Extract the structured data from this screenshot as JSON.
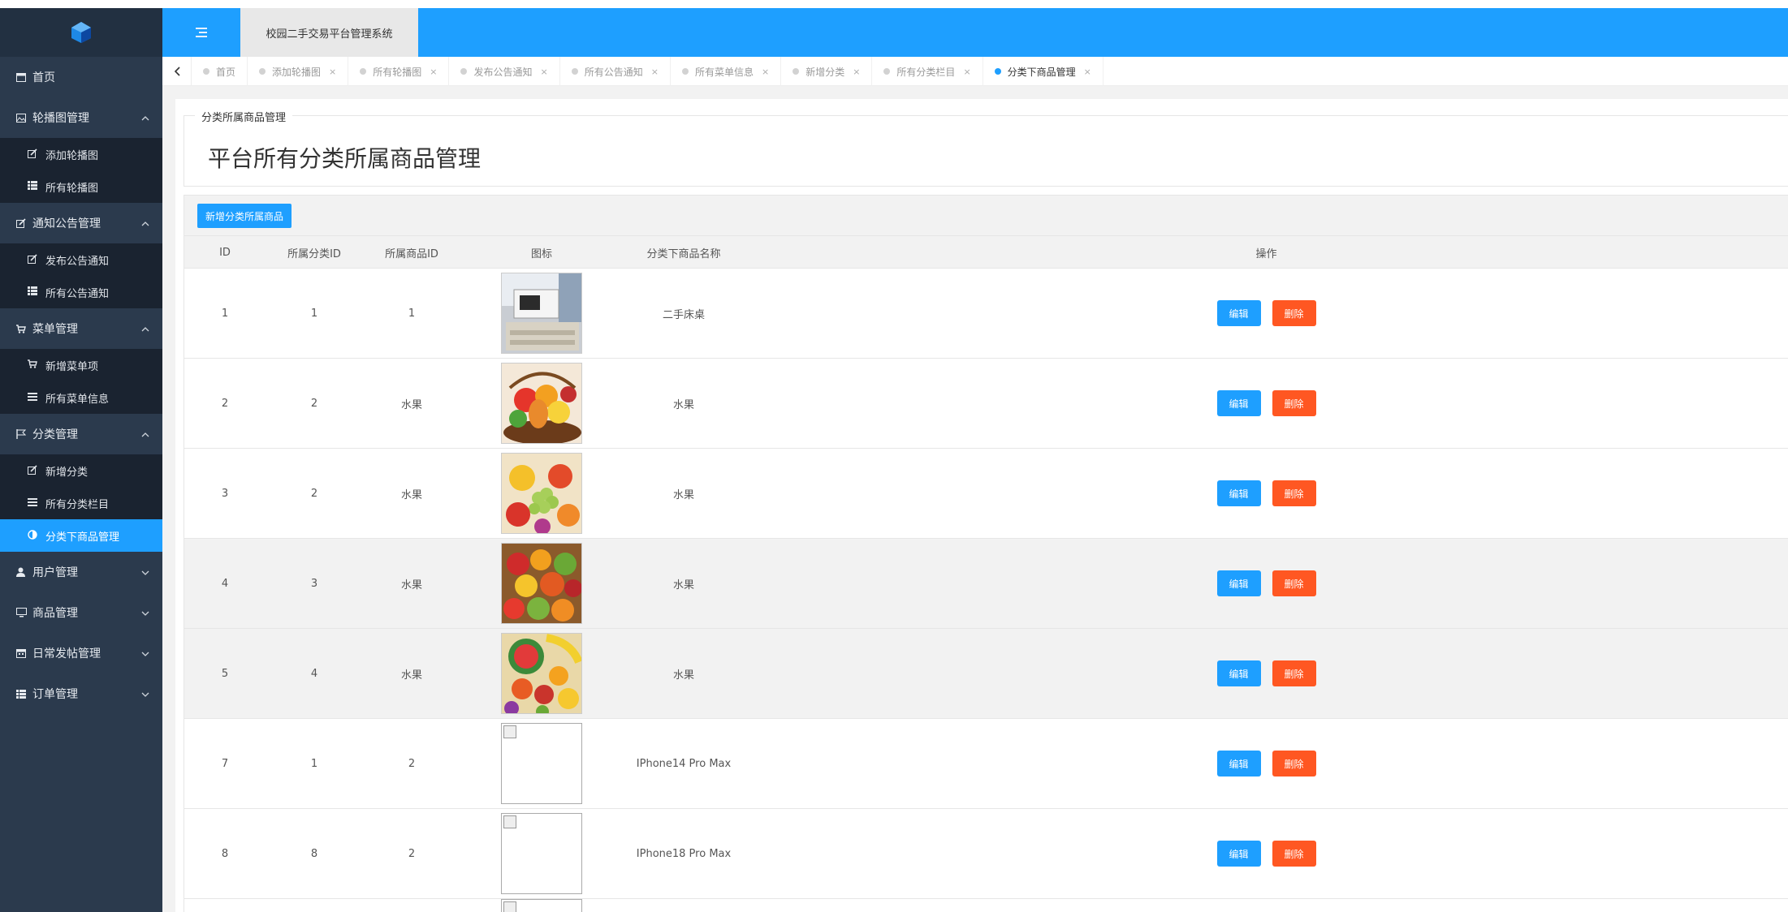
{
  "app": {
    "system_title": "校园二手交易平台管理系统"
  },
  "sidebar": {
    "home": {
      "label": "首页",
      "icon": "window-icon"
    },
    "groups": [
      {
        "label": "轮播图管理",
        "icon": "image-icon",
        "expanded": true,
        "items": [
          {
            "label": "添加轮播图",
            "icon": "edit-icon"
          },
          {
            "label": "所有轮播图",
            "icon": "list-icon"
          }
        ]
      },
      {
        "label": "通知公告管理",
        "icon": "edit-icon",
        "expanded": true,
        "items": [
          {
            "label": "发布公告通知",
            "icon": "edit-icon"
          },
          {
            "label": "所有公告通知",
            "icon": "list-icon"
          }
        ]
      },
      {
        "label": "菜单管理",
        "icon": "cart-icon",
        "expanded": true,
        "items": [
          {
            "label": "新增菜单项",
            "icon": "cart-icon"
          },
          {
            "label": "所有菜单信息",
            "icon": "menu-lines-icon"
          }
        ]
      },
      {
        "label": "分类管理",
        "icon": "flag-icon",
        "expanded": true,
        "items": [
          {
            "label": "新增分类",
            "icon": "edit-icon"
          },
          {
            "label": "所有分类栏目",
            "icon": "menu-lines-icon"
          },
          {
            "label": "分类下商品管理",
            "icon": "half-circle-icon",
            "active": true
          }
        ]
      },
      {
        "label": "用户管理",
        "icon": "user-icon",
        "expanded": false
      },
      {
        "label": "商品管理",
        "icon": "monitor-icon",
        "expanded": false
      },
      {
        "label": "日常发帖管理",
        "icon": "calendar-icon",
        "expanded": false
      },
      {
        "label": "订单管理",
        "icon": "list-icon",
        "expanded": false
      }
    ]
  },
  "tabs": [
    {
      "label": "首页",
      "closable": false
    },
    {
      "label": "添加轮播图",
      "closable": true
    },
    {
      "label": "所有轮播图",
      "closable": true
    },
    {
      "label": "发布公告通知",
      "closable": true
    },
    {
      "label": "所有公告通知",
      "closable": true
    },
    {
      "label": "所有菜单信息",
      "closable": true
    },
    {
      "label": "新增分类",
      "closable": true
    },
    {
      "label": "所有分类栏目",
      "closable": true
    },
    {
      "label": "分类下商品管理",
      "closable": true,
      "active": true
    }
  ],
  "close_glyph": "×",
  "main": {
    "legend": "分类所属商品管理",
    "page_title": "平台所有分类所属商品管理",
    "add_button": "新增分类所属商品",
    "columns": [
      "ID",
      "所属分类ID",
      "所属商品ID",
      "图标",
      "分类下商品名称",
      "操作"
    ],
    "edit_label": "编辑",
    "delete_label": "删除",
    "rows": [
      {
        "id": "1",
        "cat_id": "1",
        "goods_id": "1",
        "image": "desk-photo",
        "name": "二手床桌"
      },
      {
        "id": "2",
        "cat_id": "2",
        "goods_id": "水果",
        "image": "fruit-basket-photo",
        "name": "水果"
      },
      {
        "id": "3",
        "cat_id": "2",
        "goods_id": "水果",
        "image": "grapes-fruit-photo",
        "name": "水果"
      },
      {
        "id": "4",
        "cat_id": "3",
        "goods_id": "水果",
        "image": "fruit-pile-photo",
        "name": "水果"
      },
      {
        "id": "5",
        "cat_id": "4",
        "goods_id": "水果",
        "image": "melon-fruit-photo",
        "name": "水果"
      },
      {
        "id": "7",
        "cat_id": "1",
        "goods_id": "2",
        "image": "broken-image",
        "name": "IPhone14 Pro Max"
      },
      {
        "id": "8",
        "cat_id": "8",
        "goods_id": "2",
        "image": "broken-image",
        "name": "IPhone18 Pro Max"
      }
    ]
  },
  "colors": {
    "primary": "#1e9fff",
    "danger": "#ff5722",
    "sidebar": "#2b3a4d",
    "sidebar_sub": "#1a2330"
  }
}
